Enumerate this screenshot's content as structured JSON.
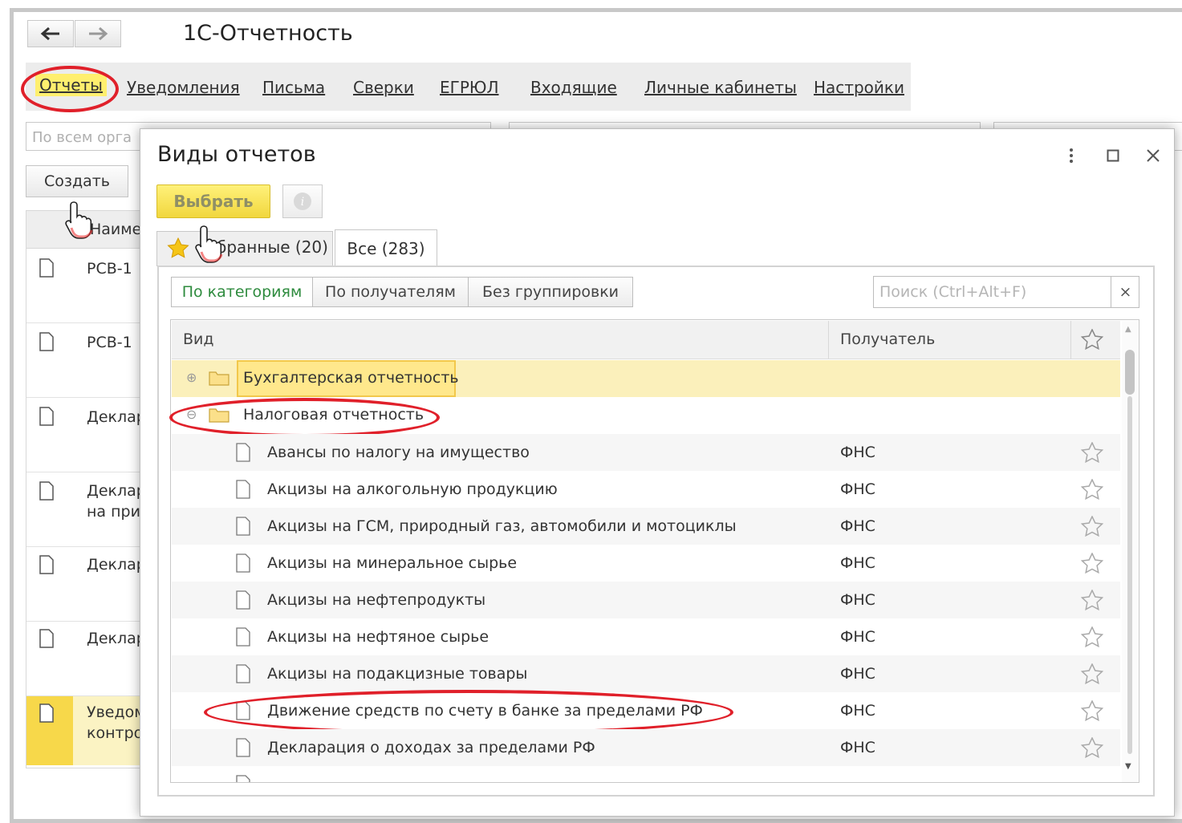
{
  "app": {
    "title": "1С-Отчетность"
  },
  "menu": {
    "items": [
      "Отчеты",
      "Уведомления",
      "Письма",
      "Сверки",
      "ЕГРЮЛ",
      "Входящие",
      "Личные кабинеты",
      "Настройки"
    ],
    "active": "Отчеты"
  },
  "background": {
    "filter_placeholder": "По всем орга",
    "create_label": "Создать",
    "column_header": "Наиме",
    "rows": [
      "РСВ-1",
      "РСВ-1",
      "Деклар",
      "Деклар\nна при",
      "Деклар",
      "Деклар",
      "Уведом\nконтро"
    ]
  },
  "dialog": {
    "title": "Виды отчетов",
    "select_label": "Выбрать",
    "tabs": {
      "favorites": "Избранные (20)",
      "favorites_visible": "бранные (20)",
      "all": "Все (283)"
    },
    "groupings": [
      "По категориям",
      "По получателям",
      "Без группировки"
    ],
    "active_grouping": "По категориям",
    "search_placeholder": "Поиск (Ctrl+Alt+F)",
    "search_clear": "×",
    "columns": {
      "kind": "Вид",
      "recipient": "Получатель"
    },
    "groups": {
      "accounting": "Бухгалтерская отчетность",
      "tax": "Налоговая отчетность"
    },
    "rows": [
      {
        "name": "Авансы по налогу на имущество",
        "recipient": "ФНС"
      },
      {
        "name": "Акцизы на алкогольную продукцию",
        "recipient": "ФНС"
      },
      {
        "name": "Акцизы на ГСМ, природный газ, автомобили и мотоциклы",
        "recipient": "ФНС"
      },
      {
        "name": "Акцизы на минеральное сырье",
        "recipient": "ФНС"
      },
      {
        "name": "Акцизы на нефтепродукты",
        "recipient": "ФНС"
      },
      {
        "name": "Акцизы на нефтяное сырье",
        "recipient": "ФНС"
      },
      {
        "name": "Акцизы на подакцизные товары",
        "recipient": "ФНС"
      },
      {
        "name": "Движение средств по счету в банке за пределами РФ",
        "recipient": "ФНС"
      },
      {
        "name": "Декларация о доходах за пределами РФ",
        "recipient": "ФНС"
      }
    ]
  },
  "colors": {
    "accent_yellow": "#ffef6e",
    "highlight_row": "#fbf0bb",
    "annotation_red": "#e0202a",
    "active_green": "#2e8b3e"
  }
}
